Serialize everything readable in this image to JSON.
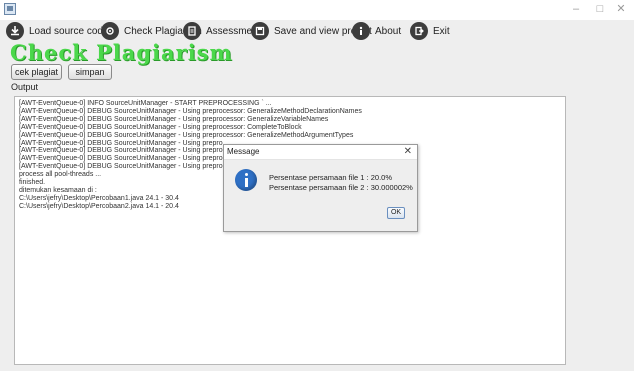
{
  "window": {
    "title": "",
    "minimize_glyph": "–",
    "maximize_glyph": "□",
    "close_glyph": "✕"
  },
  "menu": {
    "items": [
      {
        "label": "Load source code",
        "icon": "download-icon"
      },
      {
        "label": "Check Plagiarism",
        "icon": "camera-icon"
      },
      {
        "label": "Assessment",
        "icon": "clipboard-icon"
      },
      {
        "label": "Save and view project",
        "icon": "floppy-disk-icon"
      },
      {
        "label": "About",
        "icon": "info-icon"
      },
      {
        "label": "Exit",
        "icon": "exit-icon"
      }
    ]
  },
  "page": {
    "heading": "Check Plagiarism",
    "cek_button": "cek plagiat",
    "simpan_button": "simpan",
    "output_label": "Output"
  },
  "output": {
    "lines": [
      "[AWT-EventQueue-0] INFO  SourceUnitManager  - START PREPROCESSING ` ...",
      "[AWT-EventQueue-0] DEBUG SourceUnitManager  - Using preprocessor: GeneralizeMethodDeclarationNames",
      "[AWT-EventQueue-0] DEBUG SourceUnitManager  - Using preprocessor: GeneralizeVariableNames",
      "[AWT-EventQueue-0] DEBUG SourceUnitManager  - Using preprocessor: CompleteToBlock",
      "[AWT-EventQueue-0] DEBUG SourceUnitManager  - Using preprocessor: GeneralizeMethodArgumentTypes",
      "[AWT-EventQueue-0] DEBUG SourceUnitManager  - Using prepro",
      "[AWT-EventQueue-0] DEBUG SourceUnitManager  - Using prepro",
      "[AWT-EventQueue-0] DEBUG SourceUnitManager  - Using prepro",
      "[AWT-EventQueue-0] DEBUG SourceUnitManager  - Using prepro",
      "process all pool-threads ...",
      "finished.",
      "ditemukan kesamaan di :",
      "C:\\Users\\jefry\\Desktop\\Percobaan1.java 24.1 - 30.4",
      "C:\\Users\\jefry\\Desktop\\Percobaan2.java 14.1 - 20.4"
    ]
  },
  "dialog": {
    "title": "Message",
    "close_glyph": "✕",
    "line1": "Persentase persamaan file 1 : 20.0%",
    "line2": "Persentase persamaan file 2 : 30.000002%",
    "ok_label": "OK"
  },
  "colors": {
    "heading": "#4bd84b",
    "panel": "#eeeeee",
    "info_icon": "#2f70c5"
  }
}
